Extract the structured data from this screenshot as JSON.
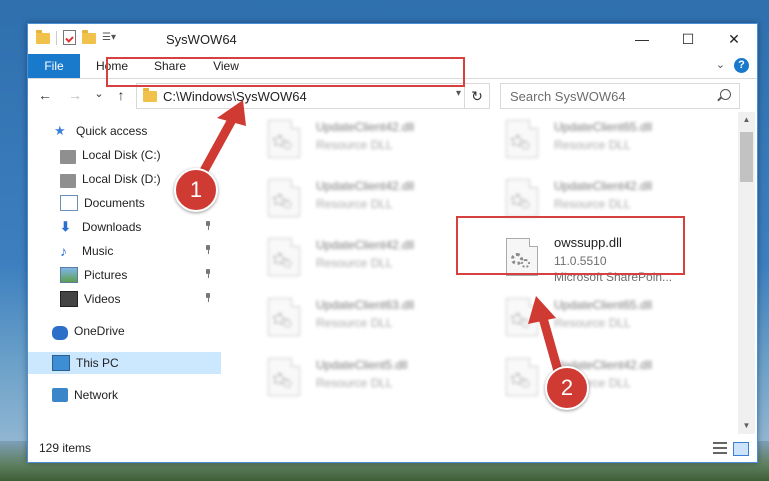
{
  "window": {
    "title": "SysWOW64",
    "controls": {
      "minimize": "—",
      "maximize": "☐",
      "close": "✕"
    }
  },
  "ribbon": {
    "tabs": [
      "File",
      "Home",
      "Share",
      "View"
    ],
    "help": "?"
  },
  "nav": {
    "back": "←",
    "forward": "→",
    "recent": "⌄",
    "up": "↑",
    "address": "C:\\Windows\\SysWOW64",
    "refresh": "↻",
    "search_placeholder": "Search SysWOW64"
  },
  "sidebar": {
    "quick_access": "Quick access",
    "items": [
      {
        "label": "Local Disk (C:)",
        "icon": "drive-icon",
        "pinned": false
      },
      {
        "label": "Local Disk (D:)",
        "icon": "drive-icon",
        "pinned": true
      },
      {
        "label": "Documents",
        "icon": "documents-icon",
        "pinned": true
      },
      {
        "label": "Downloads",
        "icon": "downloads-icon",
        "pinned": true
      },
      {
        "label": "Music",
        "icon": "music-icon",
        "pinned": true
      },
      {
        "label": "Pictures",
        "icon": "pictures-icon",
        "pinned": true
      },
      {
        "label": "Videos",
        "icon": "videos-icon",
        "pinned": true
      }
    ],
    "onedrive": "OneDrive",
    "this_pc": "This PC",
    "network": "Network"
  },
  "files": [
    {
      "name": "UpdateClient42.dll",
      "type": "Resource DLL",
      "blurred": true
    },
    {
      "name": "UpdateClient65.dll",
      "type": "Resource DLL",
      "blurred": true
    },
    {
      "name": "UpdateClient42.dll",
      "type": "Resource DLL",
      "blurred": true
    },
    {
      "name": "UpdateClient42.dll",
      "type": "Resource DLL",
      "blurred": true
    },
    {
      "name": "UpdateClient42.dll",
      "type": "Resource DLL",
      "blurred": true
    },
    {
      "name": "owssupp.dll",
      "version": "11.0.5510",
      "type": "Microsoft SharePoin...",
      "blurred": false
    },
    {
      "name": "UpdateClient63.dll",
      "type": "Resource DLL",
      "blurred": true
    },
    {
      "name": "UpdateClient65.dll",
      "type": "Resource DLL",
      "blurred": true
    },
    {
      "name": "UpdateClient5.dll",
      "type": "Resource DLL",
      "blurred": true
    },
    {
      "name": "UpdateClient42.dll",
      "type": "Resource DLL",
      "blurred": true
    }
  ],
  "status": {
    "count": "129 items"
  },
  "annotations": {
    "step1": "1",
    "step2": "2",
    "color": "#d6403f"
  }
}
